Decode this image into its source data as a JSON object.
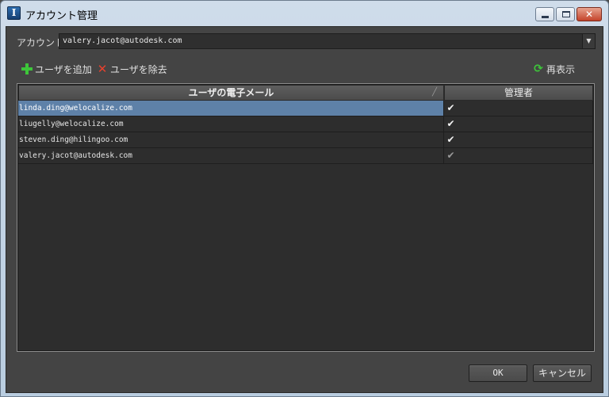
{
  "window": {
    "title": "アカウント管理",
    "icon_letter": "I"
  },
  "account": {
    "label": "アカウント:",
    "selected": "valery.jacot@autodesk.com"
  },
  "toolbar": {
    "add_user": "ユーザを追加",
    "remove_user": "ユーザを除去",
    "refresh": "再表示"
  },
  "table": {
    "columns": [
      "ユーザの電子メール",
      "管理者"
    ],
    "rows": [
      {
        "email": "linda.ding@welocalize.com",
        "admin": true,
        "enabled": true
      },
      {
        "email": "liugelly@welocalize.com",
        "admin": true,
        "enabled": true
      },
      {
        "email": "steven.ding@hilingoo.com",
        "admin": true,
        "enabled": true
      },
      {
        "email": "valery.jacot@autodesk.com",
        "admin": true,
        "enabled": false
      }
    ]
  },
  "buttons": {
    "ok": "OK",
    "cancel": "キャンセル"
  },
  "icons": {
    "add": "plus-icon",
    "remove": "x-icon",
    "refresh": "refresh-icon",
    "dropdown": "chevron-down-icon"
  },
  "colors": {
    "selection": "#5e81a8",
    "add_green": "#3dc63a",
    "remove_red": "#e6412e"
  }
}
